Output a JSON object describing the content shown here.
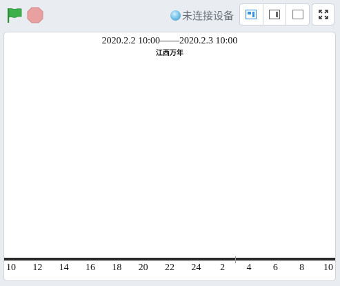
{
  "toolbar": {
    "flag_icon": "green-flag-icon",
    "stop_icon": "stop-icon",
    "connection_status": "未连接设备",
    "layout_buttons": [
      "layout-split-icon",
      "layout-sidebar-icon",
      "layout-single-icon"
    ],
    "fullscreen_icon": "fullscreen-icon"
  },
  "chart": {
    "range_title": "2020.2.2 10:00——2020.2.3 10:00",
    "subtitle": "江西万年",
    "x_ticks": [
      "10",
      "12",
      "14",
      "16",
      "18",
      "20",
      "22",
      "24",
      "2",
      "4",
      "6",
      "8",
      "10"
    ]
  },
  "colors": {
    "flag": "#3cb14a",
    "stop": "#e8a0a0",
    "accent": "#3b8fe0",
    "background": "#e9ecf1"
  }
}
